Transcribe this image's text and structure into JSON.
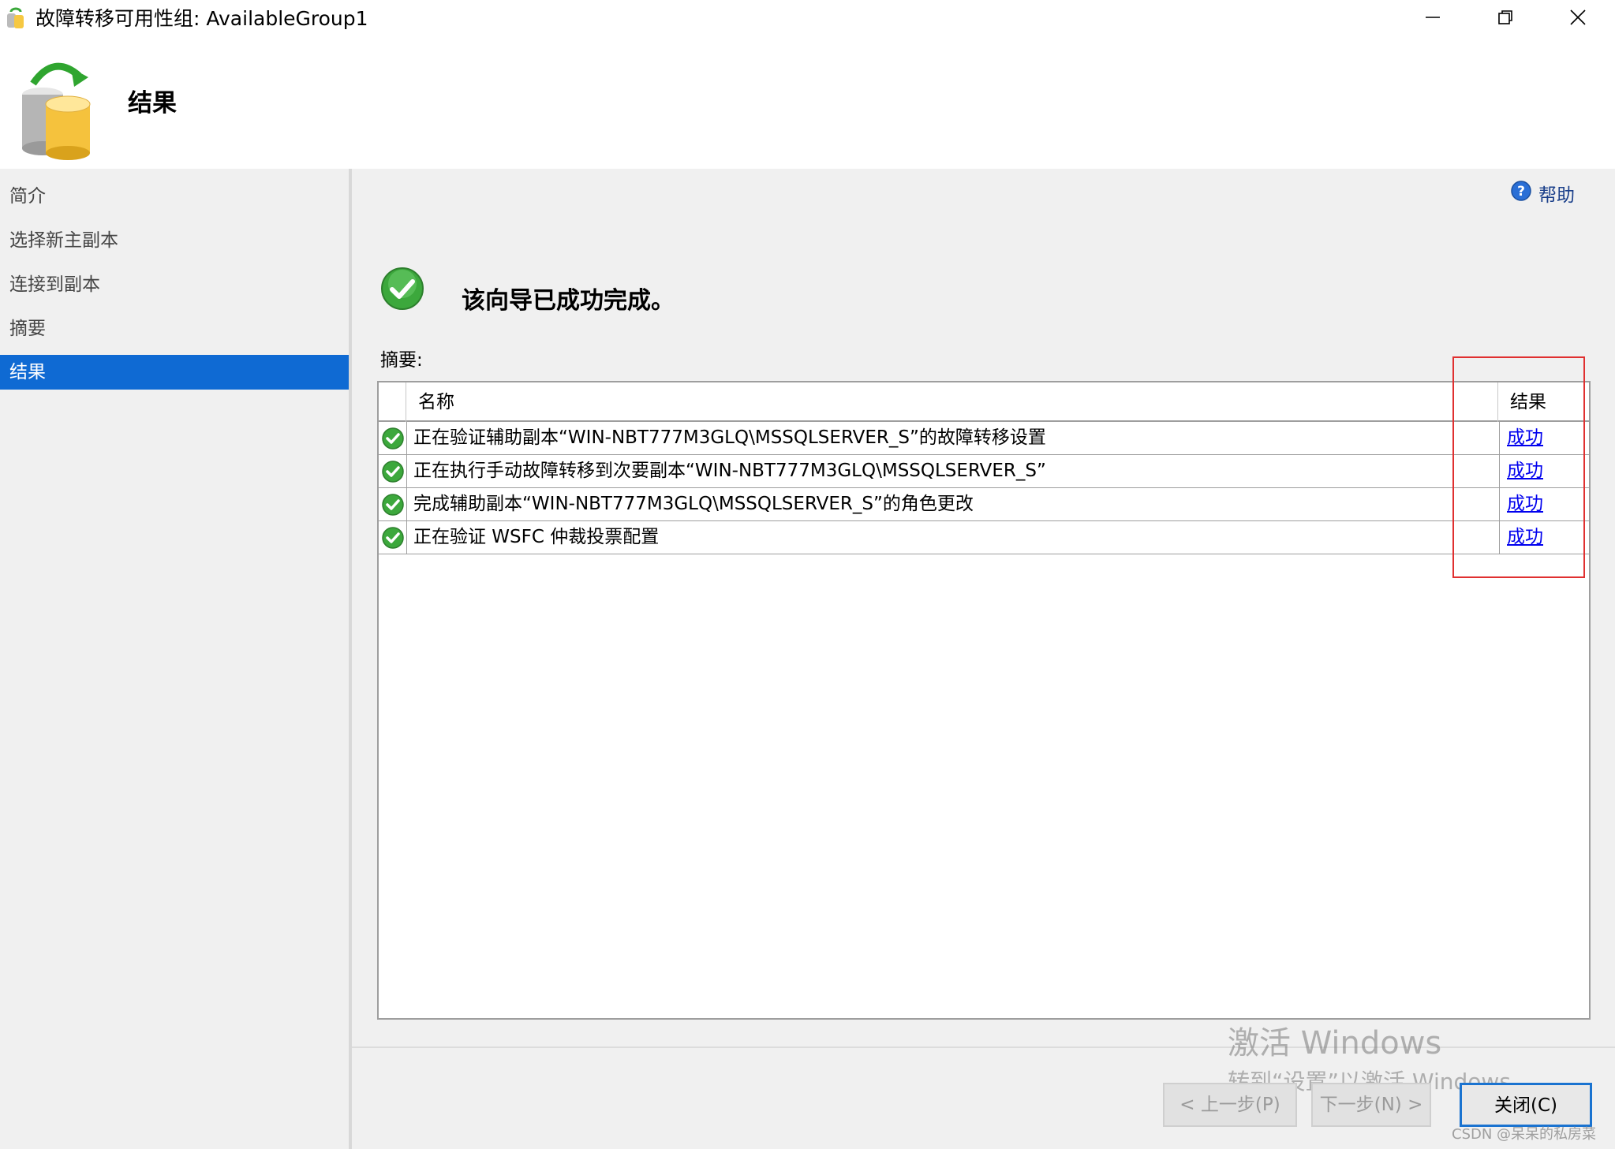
{
  "window": {
    "title": "故障转移可用性组: AvailableGroup1",
    "icon": "database-failover-icon",
    "controls": [
      "minimize-icon",
      "restore-icon",
      "close-icon"
    ]
  },
  "header": {
    "heading": "结果",
    "icon": "database-failover-icon"
  },
  "nav": {
    "items": [
      {
        "label": "简介",
        "active": false
      },
      {
        "label": "选择新主副本",
        "active": false
      },
      {
        "label": "连接到副本",
        "active": false
      },
      {
        "label": "摘要",
        "active": false
      },
      {
        "label": "结果",
        "active": true
      }
    ],
    "active_color": "#0f6ad3"
  },
  "help": {
    "label": "帮助",
    "icon": "help-icon"
  },
  "status": {
    "message": "该向导已成功完成。",
    "icon": "success-check-icon"
  },
  "summary": {
    "label": "摘要:",
    "columns": {
      "name": "名称",
      "result": "结果"
    },
    "rows": [
      {
        "name": "正在验证辅助副本“WIN-NBT777M3GLQ\\MSSQLSERVER_S”的故障转移设置",
        "result": "成功"
      },
      {
        "name": "正在执行手动故障转移到次要副本“WIN-NBT777M3GLQ\\MSSQLSERVER_S”",
        "result": "成功"
      },
      {
        "name": "完成辅助副本“WIN-NBT777M3GLQ\\MSSQLSERVER_S”的角色更改",
        "result": "成功"
      },
      {
        "name": "正在验证 WSFC 仲裁投票配置",
        "result": "成功"
      }
    ]
  },
  "buttons": {
    "prev": "< 上一步(P)",
    "next": "下一步(N) >",
    "close": "关闭(C)"
  },
  "watermark": {
    "line1": "激活 Windows",
    "line2": "转到“设置”以激活 Windows。",
    "credit": "CSDN @呆呆的私房菜"
  },
  "colors": {
    "highlight_box": "#e03030",
    "link": "#0000ee"
  }
}
